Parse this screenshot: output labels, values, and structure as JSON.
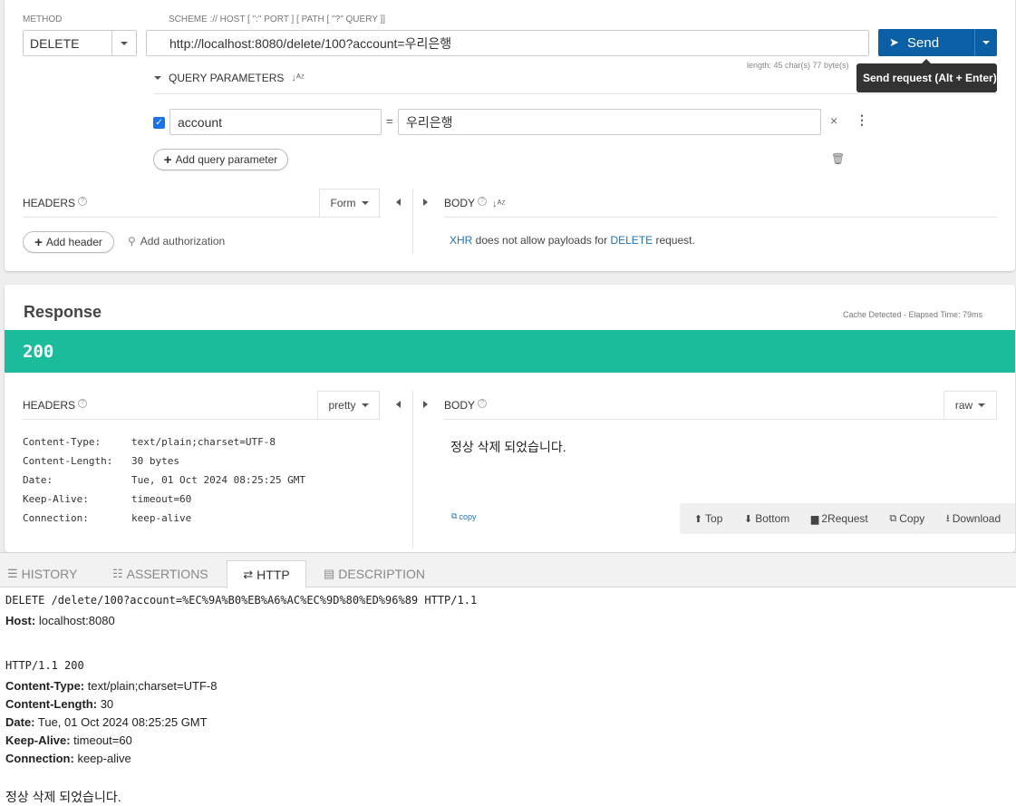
{
  "request": {
    "method_label": "METHOD",
    "method": "DELETE",
    "url_label": "SCHEME :// HOST [ \":\" PORT ] [ PATH [ \"?\" QUERY ]]",
    "url": "http://localhost:8080/delete/100?account=우리은행",
    "length_info": "length: 45 char(s) 77 byte(s)",
    "send_label": "Send",
    "send_tooltip": "Send request (Alt + Enter)",
    "query_params_title": "QUERY PARAMETERS",
    "params": [
      {
        "enabled": true,
        "name": "account",
        "equals": "=",
        "value": "우리은행"
      }
    ],
    "add_param_label": "Add query parameter",
    "headers_title": "HEADERS",
    "form_label": "Form",
    "add_header_label": "Add header",
    "add_auth_label": "Add authorization",
    "body_title": "BODY",
    "body_msg_xhr": "XHR",
    "body_msg_mid": " does not allow payloads for ",
    "body_msg_method": "DELETE",
    "body_msg_end": " request."
  },
  "response": {
    "title": "Response",
    "cache_info": "Cache Detected - Elapsed Time: 79ms",
    "status": "200",
    "status_color": "#1abc9c",
    "headers_title": "HEADERS",
    "pretty_label": "pretty",
    "headers": [
      {
        "name": "Content-Type:",
        "value": "text/plain;charset=UTF-8"
      },
      {
        "name": "Content-Length:",
        "value": "30 bytes"
      },
      {
        "name": "Date:",
        "value": "Tue, 01 Oct 2024 08:25:25 GMT"
      },
      {
        "name": "Keep-Alive:",
        "value": "timeout=60"
      },
      {
        "name": "Connection:",
        "value": "keep-alive"
      }
    ],
    "body_title": "BODY",
    "raw_label": "raw",
    "body_text": "정상 삭제 되었습니다.",
    "copy_label": "copy",
    "toolbar": {
      "top": "Top",
      "bottom": "Bottom",
      "to_request": "2Request",
      "copy": "Copy",
      "download": "Download"
    }
  },
  "bottom_tabs": {
    "history": "HISTORY",
    "assertions": "ASSERTIONS",
    "http": "HTTP",
    "description": "DESCRIPTION"
  },
  "http_log": {
    "request_line": "DELETE /delete/100?account=%EC%9A%B0%EB%A6%AC%EC%9D%80%ED%96%89 HTTP/1.1",
    "host_key": "Host:",
    "host_value": " localhost:8080",
    "status_line": "HTTP/1.1 200",
    "headers": [
      {
        "key": "Content-Type:",
        "value": " text/plain;charset=UTF-8"
      },
      {
        "key": "Content-Length:",
        "value": " 30"
      },
      {
        "key": "Date:",
        "value": " Tue, 01 Oct 2024 08:25:25 GMT"
      },
      {
        "key": "Keep-Alive:",
        "value": " timeout=60"
      },
      {
        "key": "Connection:",
        "value": " keep-alive"
      }
    ],
    "body": "정상 삭제 되었습니다."
  },
  "colors": {
    "send_button": "#0b5fa5",
    "link": "#1a73b8"
  }
}
